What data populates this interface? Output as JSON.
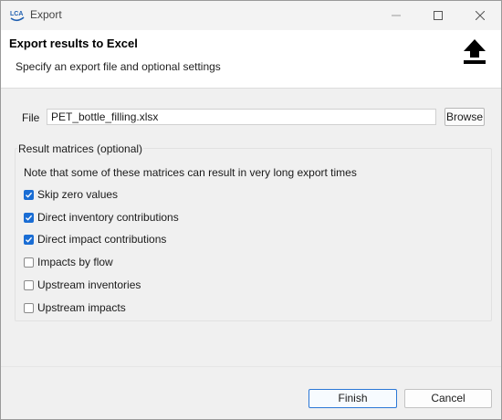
{
  "window": {
    "title": "Export",
    "logo_text": "LCA"
  },
  "header": {
    "title": "Export results to Excel",
    "subtitle": "Specify an export file and optional settings"
  },
  "file": {
    "label": "File",
    "value": "PET_bottle_filling.xlsx",
    "browse_label": "Browse"
  },
  "result_matrices": {
    "legend": "Result matrices (optional)",
    "note": "Note that some of these matrices can result in very long export times",
    "options": [
      {
        "label": "Skip zero values",
        "checked": true
      },
      {
        "label": "Direct inventory contributions",
        "checked": true
      },
      {
        "label": "Direct impact contributions",
        "checked": true
      },
      {
        "label": "Impacts by flow",
        "checked": false
      },
      {
        "label": "Upstream inventories",
        "checked": false
      },
      {
        "label": "Upstream impacts",
        "checked": false
      }
    ]
  },
  "buttons": {
    "finish": "Finish",
    "cancel": "Cancel"
  },
  "colors": {
    "accent": "#1a6dd4",
    "logo": "#1f5fb0"
  }
}
